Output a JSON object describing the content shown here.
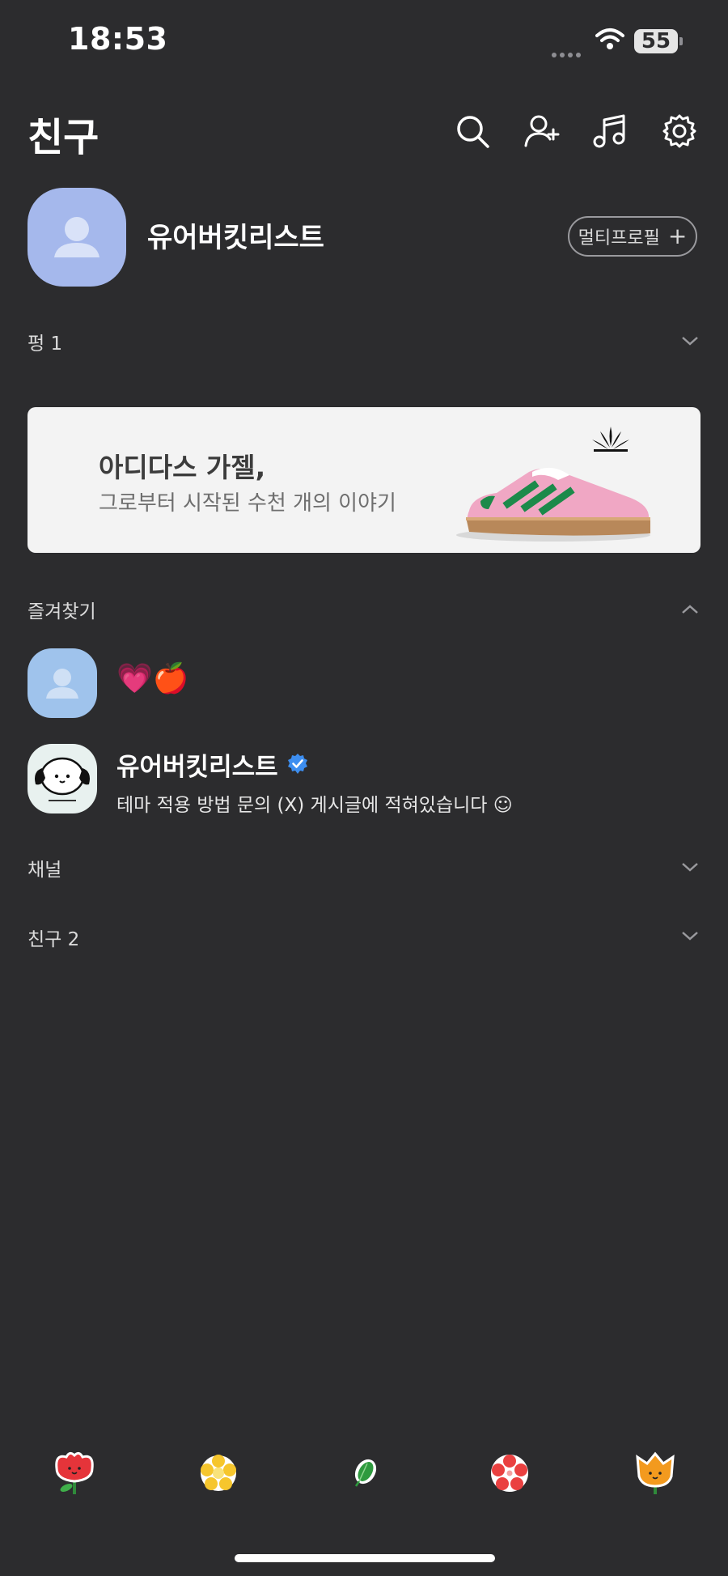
{
  "status_bar": {
    "time": "18:53",
    "battery": "55"
  },
  "header": {
    "title": "친구",
    "icons": [
      "search-icon",
      "add-friend-icon",
      "music-icon",
      "settings-icon"
    ]
  },
  "my_profile": {
    "name": "유어버킷리스트",
    "multi_profile_label": "멀티프로필"
  },
  "sections": {
    "pung": "펑 1",
    "favorites": "즐겨찾기",
    "channel": "채널",
    "friends": "친구 2"
  },
  "banner": {
    "title": "아디다스 가젤,",
    "subtitle": "그로부터 시작된 수천 개의 이야기"
  },
  "favorites": [
    {
      "status": "💗🍎"
    },
    {
      "name": "유어버킷리스트",
      "message": "테마 적용 방법 문의 (X) 게시글에 적혀있습니다 ☺"
    }
  ],
  "bottom_tabs": [
    "friends-tab",
    "chats-tab",
    "openchat-tab",
    "shopping-tab",
    "more-tab"
  ],
  "colors": {
    "background": "#2c2c2e",
    "my_avatar": "#a5b8ec",
    "verified": "#3d8ef0"
  }
}
